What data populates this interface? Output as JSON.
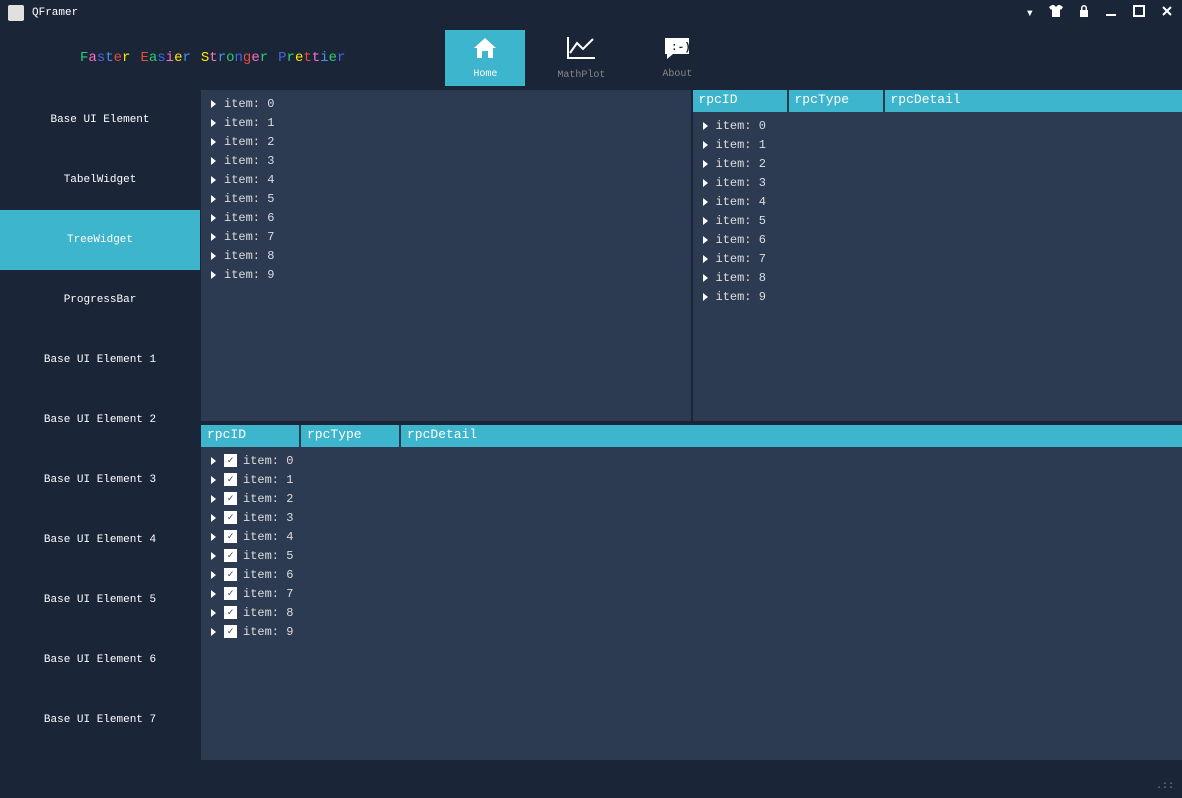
{
  "titlebar": {
    "title": "QFramer"
  },
  "motto": {
    "word1": [
      {
        "ch": "F",
        "color": "#2ecc71"
      },
      {
        "ch": "a",
        "color": "#ff6ec7"
      },
      {
        "ch": "s",
        "color": "#4169e1"
      },
      {
        "ch": "t",
        "color": "#4a90e2"
      },
      {
        "ch": "e",
        "color": "#e74c3c"
      },
      {
        "ch": "r",
        "color": "#ffe600"
      }
    ],
    "word2": [
      {
        "ch": "E",
        "color": "#e74c3c"
      },
      {
        "ch": "a",
        "color": "#2ecc71"
      },
      {
        "ch": "s",
        "color": "#4169e1"
      },
      {
        "ch": "i",
        "color": "#ff6ec7"
      },
      {
        "ch": "e",
        "color": "#ffe600"
      },
      {
        "ch": "r",
        "color": "#4a90e2"
      }
    ],
    "word3": [
      {
        "ch": "S",
        "color": "#ffe600"
      },
      {
        "ch": "t",
        "color": "#ff6ec7"
      },
      {
        "ch": "r",
        "color": "#4a90e2"
      },
      {
        "ch": "o",
        "color": "#2ecc71"
      },
      {
        "ch": "n",
        "color": "#4169e1"
      },
      {
        "ch": "g",
        "color": "#e74c3c"
      },
      {
        "ch": "e",
        "color": "#ff6ec7"
      },
      {
        "ch": "r",
        "color": "#2ecc71"
      }
    ],
    "word4": [
      {
        "ch": "P",
        "color": "#4169e1"
      },
      {
        "ch": "r",
        "color": "#2ecc71"
      },
      {
        "ch": "e",
        "color": "#ffe600"
      },
      {
        "ch": "t",
        "color": "#e74c3c"
      },
      {
        "ch": "t",
        "color": "#ff6ec7"
      },
      {
        "ch": "i",
        "color": "#4a90e2"
      },
      {
        "ch": "e",
        "color": "#2ecc71"
      },
      {
        "ch": "r",
        "color": "#4169e1"
      }
    ]
  },
  "tabs": [
    {
      "label": "Home",
      "active": true
    },
    {
      "label": "MathPlot",
      "active": false
    },
    {
      "label": "About",
      "active": false
    }
  ],
  "sidebar": {
    "items": [
      {
        "label": "Base UI Element",
        "active": false
      },
      {
        "label": "TabelWidget",
        "active": false
      },
      {
        "label": "TreeWidget",
        "active": true
      },
      {
        "label": "ProgressBar",
        "active": false
      },
      {
        "label": "Base UI Element 1",
        "active": false
      },
      {
        "label": "Base UI Element 2",
        "active": false
      },
      {
        "label": "Base UI Element 3",
        "active": false
      },
      {
        "label": "Base UI Element 4",
        "active": false
      },
      {
        "label": "Base UI Element 5",
        "active": false
      },
      {
        "label": "Base UI Element 6",
        "active": false
      },
      {
        "label": "Base UI Element 7",
        "active": false
      }
    ]
  },
  "headers": {
    "col1": "rpcID",
    "col2": "rpcType",
    "col3": "rpcDetail"
  },
  "tree1": {
    "items": [
      "item: 0",
      "item: 1",
      "item: 2",
      "item: 3",
      "item: 4",
      "item: 5",
      "item: 6",
      "item: 7",
      "item: 8",
      "item: 9"
    ]
  },
  "tree2": {
    "items": [
      "item: 0",
      "item: 1",
      "item: 2",
      "item: 3",
      "item: 4",
      "item: 5",
      "item: 6",
      "item: 7",
      "item: 8",
      "item: 9"
    ]
  },
  "tree3": {
    "items": [
      "item: 0",
      "item: 1",
      "item: 2",
      "item: 3",
      "item: 4",
      "item: 5",
      "item: 6",
      "item: 7",
      "item: 8",
      "item: 9"
    ]
  }
}
